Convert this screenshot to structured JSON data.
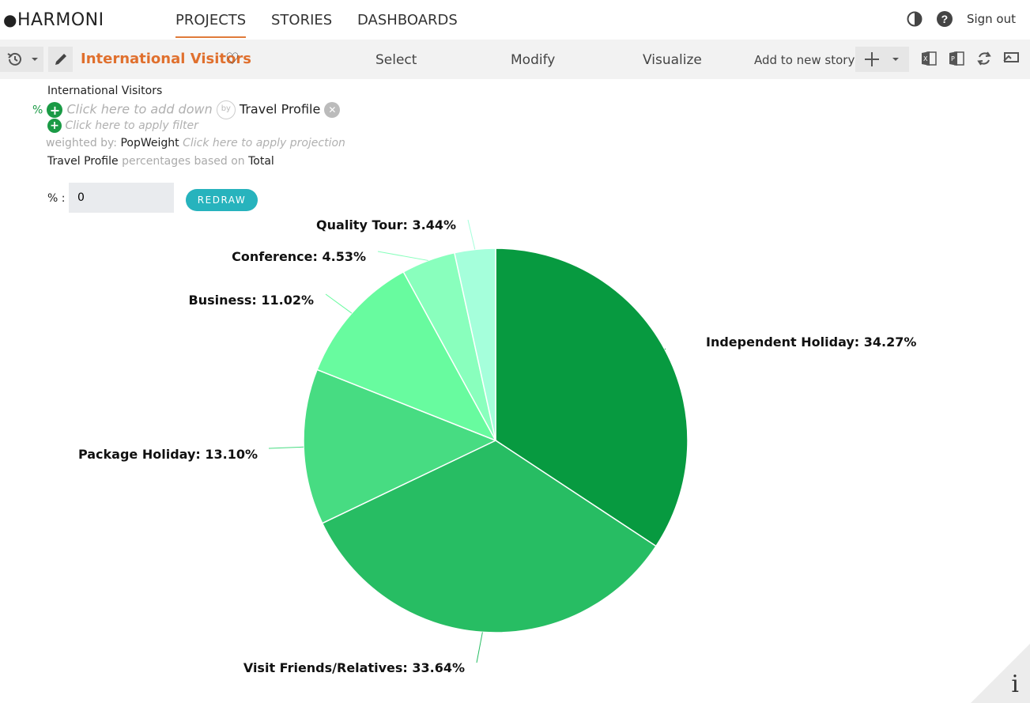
{
  "app": {
    "logo_text": "HARMONI"
  },
  "nav": {
    "items": [
      "PROJECTS",
      "STORIES",
      "DASHBOARDS"
    ],
    "active": "PROJECTS"
  },
  "header": {
    "sign_out": "Sign out"
  },
  "toolbar": {
    "title": "International Visitors",
    "tabs": [
      "Select",
      "Modify",
      "Visualize"
    ],
    "add_story": "Add to new story"
  },
  "query": {
    "name": "International Visitors",
    "pct_label": "%",
    "down_placeholder": "Click here to add down",
    "by_label": "by",
    "across": "Travel Profile",
    "filter_placeholder": "Click here to apply filter",
    "weighted_label": "weighted by:",
    "weight": "PopWeight",
    "projection_placeholder": "Click here to apply projection",
    "pct_var": "Travel Profile",
    "pct_based_label": "percentages based on",
    "pct_base": "Total"
  },
  "threshold": {
    "label": "% :",
    "value": "0",
    "button": "REDRAW"
  },
  "chart_data": {
    "type": "pie",
    "labels": [
      "Independent Holiday",
      "Visit Friends/Relatives",
      "Package Holiday",
      "Business",
      "Conference",
      "Quality Tour"
    ],
    "values": [
      34.27,
      33.64,
      13.1,
      11.02,
      4.53,
      3.44
    ],
    "display_labels": [
      "Independent Holiday: 34.27%",
      "Visit Friends/Relatives: 33.64%",
      "Package Holiday: 13.10%",
      "Business: 11.02%",
      "Conference: 4.53%",
      "Quality Tour: 3.44%"
    ],
    "colors": [
      "#079a40",
      "#27bd63",
      "#47dc82",
      "#68fb9f",
      "#89ffbd",
      "#a5ffdb"
    ]
  }
}
